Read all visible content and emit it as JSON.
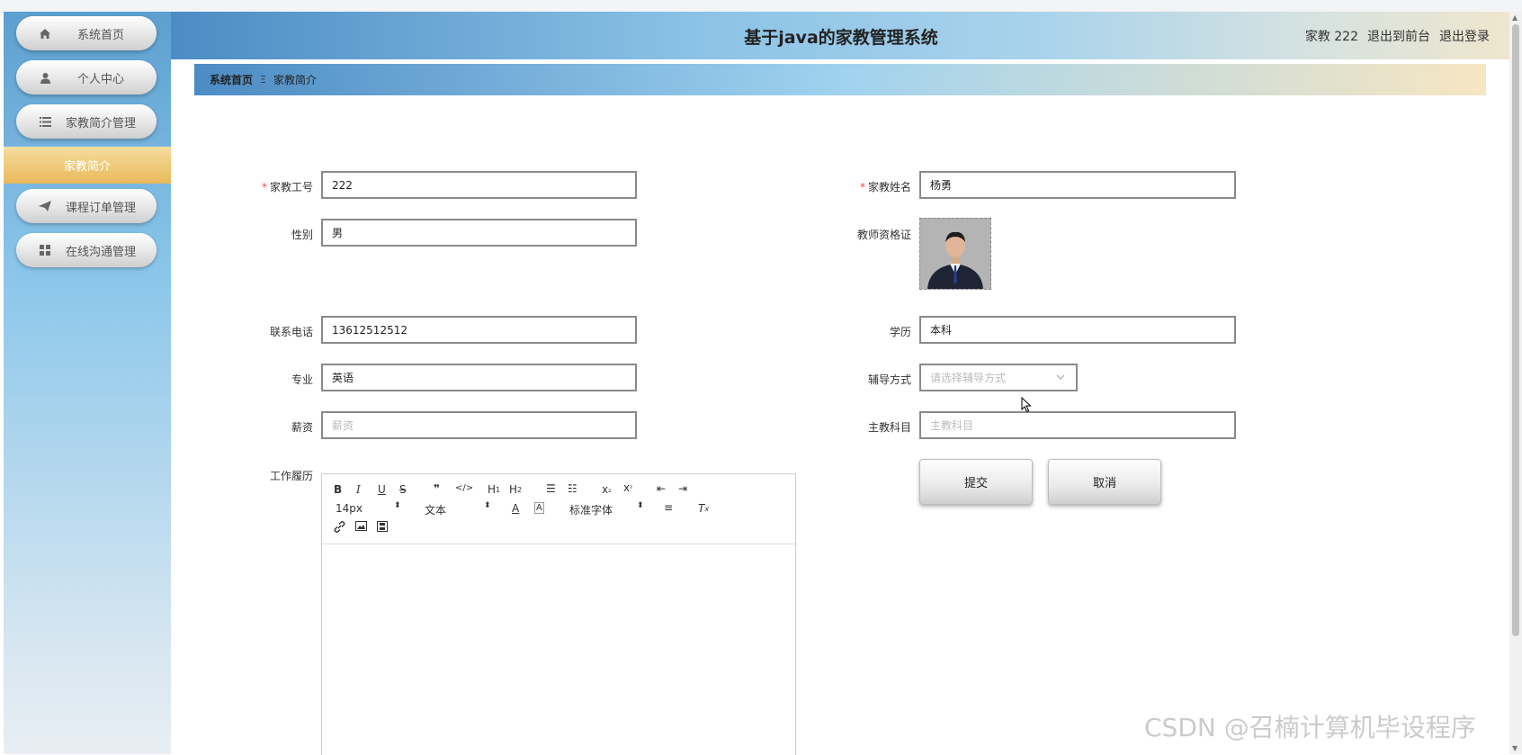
{
  "header": {
    "title": "基于java的家教管理系统",
    "user": "家教 222",
    "front_link": "退出到前台",
    "logout_link": "退出登录"
  },
  "sidebar": {
    "items": [
      {
        "label": "系统首页",
        "icon": "home-icon"
      },
      {
        "label": "个人中心",
        "icon": "user-icon"
      },
      {
        "label": "家教简介管理",
        "icon": "list-icon"
      },
      {
        "label": "课程订单管理",
        "icon": "send-icon"
      },
      {
        "label": "在线沟通管理",
        "icon": "grid-icon"
      }
    ],
    "active_sub": "家教简介"
  },
  "breadcrumb": {
    "home": "系统首页",
    "separator": "Ξ",
    "current": "家教简介"
  },
  "form": {
    "tutor_no": {
      "label": "家教工号",
      "value": "222"
    },
    "tutor_name": {
      "label": "家教姓名",
      "value": "杨勇"
    },
    "gender": {
      "label": "性别",
      "value": "男"
    },
    "certificate": {
      "label": "教师资格证"
    },
    "phone": {
      "label": "联系电话",
      "value": "13612512512"
    },
    "education": {
      "label": "学历",
      "value": "本科"
    },
    "major": {
      "label": "专业",
      "value": "英语"
    },
    "tutoring_mode": {
      "label": "辅导方式",
      "placeholder": "请选择辅导方式"
    },
    "salary": {
      "label": "薪资",
      "placeholder": "薪资"
    },
    "subject": {
      "label": "主教科目",
      "placeholder": "主教科目"
    },
    "experience": {
      "label": "工作履历"
    },
    "submit_label": "提交",
    "cancel_label": "取消"
  },
  "editor": {
    "font_size": "14px",
    "text_type": "文本",
    "font_family": "标准字体"
  },
  "watermark": "CSDN @召楠计算机毕设程序",
  "colors": {
    "header_start": "#4c8cc4",
    "sidebar_active": "#e8b95a",
    "required": "#e74c3c"
  }
}
